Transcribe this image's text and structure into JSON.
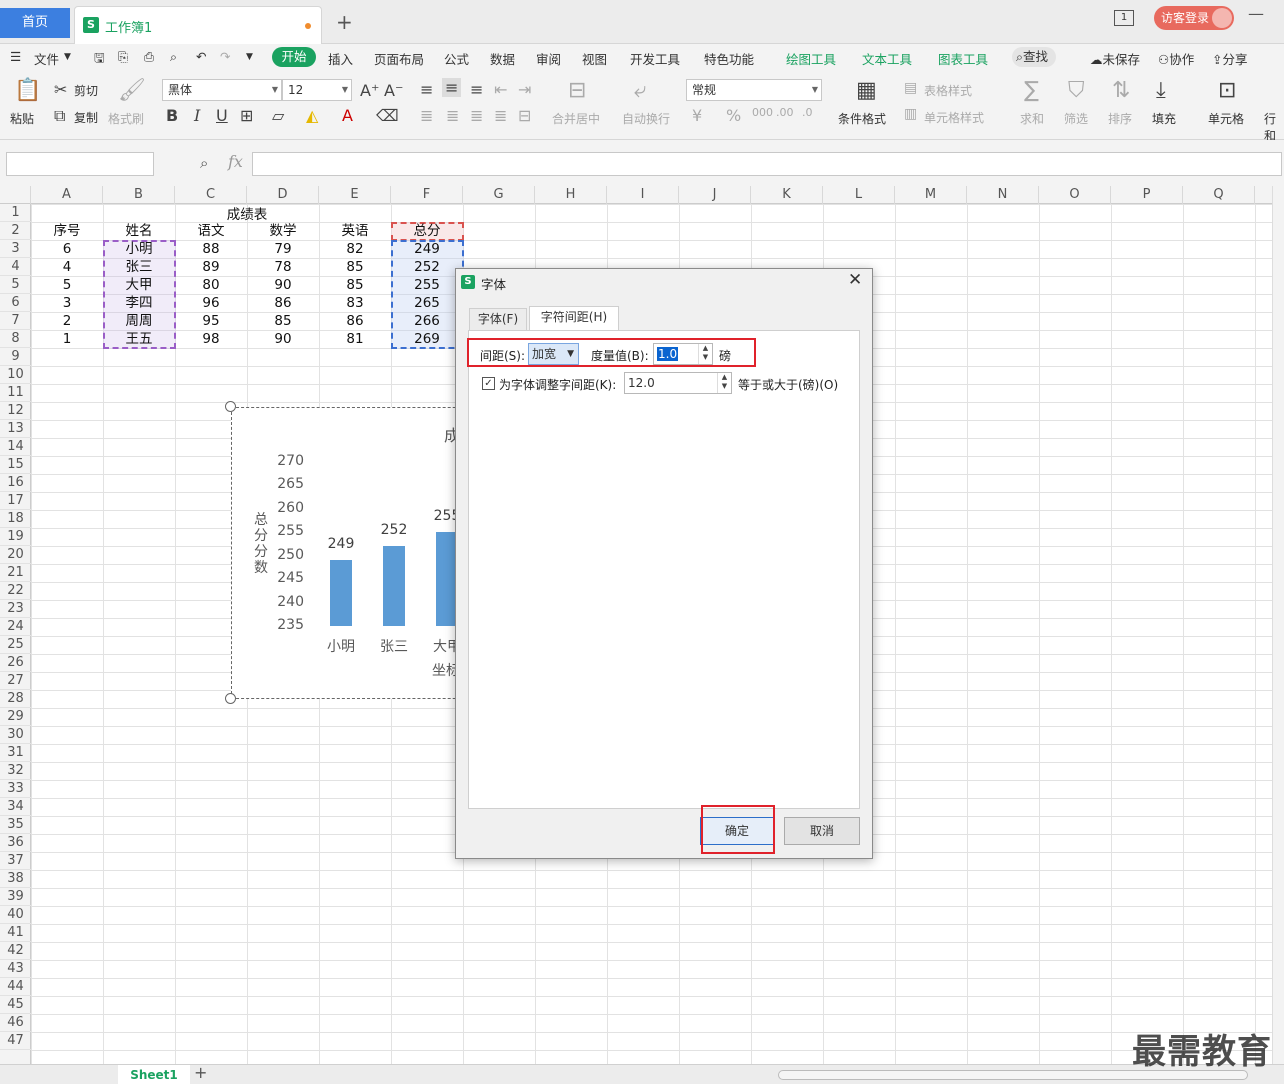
{
  "tabbar": {
    "home": "首页",
    "doc_logo": "S",
    "doc_name": "工作簿1",
    "new_tab": "+",
    "window_count": "1",
    "login": "访客登录"
  },
  "menubar": {
    "file": "文件",
    "start": "开始",
    "items": [
      "插入",
      "页面布局",
      "公式",
      "数据",
      "审阅",
      "视图",
      "开发工具",
      "特色功能"
    ],
    "context_items": [
      "绘图工具",
      "文本工具",
      "图表工具"
    ],
    "search": "查找",
    "unsaved": "未保存",
    "collab": "协作",
    "share": "分享"
  },
  "ribbon": {
    "paste": "粘贴",
    "cut": "剪切",
    "copy": "复制",
    "format_painter": "格式刷",
    "font_name": "黑体",
    "font_size": "12",
    "bold": "B",
    "italic": "I",
    "underline": "U",
    "merge_center": "合并居中",
    "wrap": "自动换行",
    "number_format": "常规",
    "cond_format": "条件格式",
    "table_style": "表格样式",
    "cell_style": "单元格样式",
    "sum": "求和",
    "filter": "筛选",
    "sort": "排序",
    "fill": "填充",
    "cell": "单元格",
    "row_col": "行和"
  },
  "formula": {
    "fx": "fx"
  },
  "sheet": {
    "columns": [
      "A",
      "B",
      "C",
      "D",
      "E",
      "F",
      "G",
      "H",
      "I",
      "J",
      "K",
      "L",
      "M",
      "N",
      "O",
      "P",
      "Q"
    ],
    "title": "成绩表",
    "headers": [
      "序号",
      "姓名",
      "语文",
      "数学",
      "英语",
      "总分"
    ],
    "rows": [
      [
        "6",
        "小明",
        "88",
        "79",
        "82",
        "249"
      ],
      [
        "4",
        "张三",
        "89",
        "78",
        "85",
        "252"
      ],
      [
        "5",
        "大甲",
        "80",
        "90",
        "85",
        "255"
      ],
      [
        "3",
        "李四",
        "96",
        "86",
        "83",
        "265"
      ],
      [
        "2",
        "周周",
        "95",
        "85",
        "86",
        "266"
      ],
      [
        "1",
        "王五",
        "98",
        "90",
        "81",
        "269"
      ]
    ]
  },
  "chart_data": {
    "type": "bar",
    "title": "成",
    "ylabel": "总分分数",
    "xlabel": "坐标",
    "categories": [
      "小明",
      "张三",
      "大甲"
    ],
    "values": [
      249,
      252,
      255
    ],
    "yticks": [
      "270",
      "265",
      "260",
      "255",
      "250",
      "245",
      "240",
      "235"
    ],
    "ylim": [
      235,
      270
    ],
    "color": "#5b9bd5"
  },
  "dialog": {
    "logo": "S",
    "title": "字体",
    "tab_font": "字体(F)",
    "tab_spacing": "字符间距(H)",
    "spacing_label": "间距(S):",
    "spacing_value": "加宽",
    "measure_label": "度量值(B):",
    "measure_value": "1.0",
    "unit": "磅",
    "kerning_label": "为字体调整字间距(K):",
    "kerning_value": "12.0",
    "kerning_suffix": "等于或大于(磅)(O)",
    "ok": "确定",
    "cancel": "取消"
  },
  "bottom": {
    "sheet_tab": "Sheet1",
    "add": "+"
  },
  "watermark": "最需教育"
}
